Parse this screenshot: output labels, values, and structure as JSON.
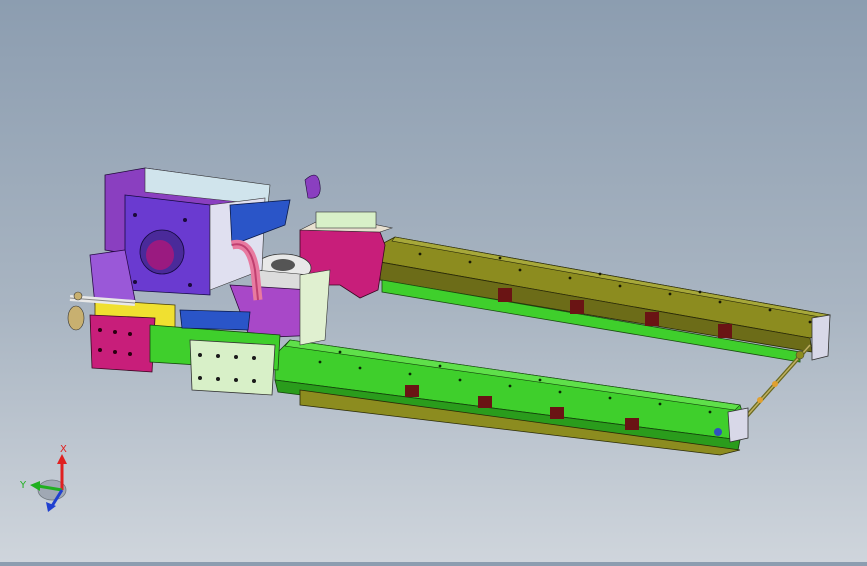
{
  "viewport": {
    "background_top": "#8c9db0",
    "background_bottom": "#cfd5dc"
  },
  "colors": {
    "olive": "#8c8c1f",
    "olive_dark": "#5f6314",
    "green": "#3fcf2c",
    "green_dark": "#2a8c1c",
    "magenta": "#c81e7a",
    "purple": "#8a3fc0",
    "violet": "#6a3ad0",
    "light_green": "#d8f0c8",
    "yellow": "#f0e030",
    "blue": "#2a55c8",
    "maroon": "#6a1414",
    "orange": "#e0a030",
    "pink": "#e87aa0"
  },
  "triad": {
    "x_label": "X",
    "y_label": "Y",
    "x_color": "#e02020",
    "y_color": "#20b020",
    "z_color": "#2040d0",
    "x_icon": "axis-x-arrow",
    "y_icon": "axis-y-arrow",
    "z_icon": "axis-z-arrow"
  }
}
